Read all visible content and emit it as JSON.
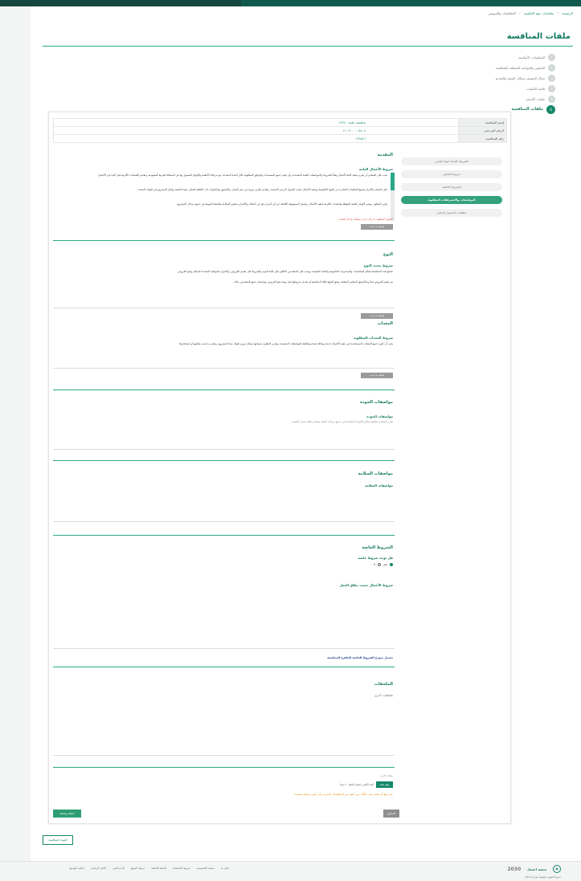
{
  "breadcrumb": [
    "الرئيسية",
    "منافسات جهة الحكومة",
    "المنافسات والعروض"
  ],
  "page_title": "ملفات المنافسة",
  "steps": [
    {
      "num": "1",
      "label": "المعلومات الأساسية"
    },
    {
      "num": "2",
      "label": "العناوين والمواعيد المتعلقة بالمنافسة"
    },
    {
      "num": "3",
      "label": "مجال التصنيف ومكان التنفيذ والتقديم"
    },
    {
      "num": "4",
      "label": "قائمة الكميات"
    },
    {
      "num": "5",
      "label": "ملفات الأسعار"
    },
    {
      "num": "6",
      "label": "ملفات المنافسة"
    }
  ],
  "summary": [
    {
      "label": "إسم المنافسة",
      "value": "منافسة عامة - ١٢٣٤"
    },
    {
      "label": "الرقم المرجعي",
      "value": "٢١٠٣٠٠٠٠٠٥٤٠٨"
    },
    {
      "label": "رقم المنافسة",
      "value": "١٢٣٥٤٦"
    }
  ],
  "tabs": [
    {
      "label": "الشروط العامة/ أنواع التقارير"
    },
    {
      "label": "شروط الفحص"
    },
    {
      "label": "الشروط الخاصة"
    },
    {
      "label": "المواصفات والاشتراطات المطلوبة"
    },
    {
      "label": "متطلبات المحتوى المحلي"
    }
  ],
  "sections": {
    "scope": {
      "title": "المقدمة",
      "sub": "شروط الأعمال العامة",
      "para1": "يجب على المتقدم أن يلتزم بتنفيذ كافة الأعمال وفقاً للشروط والمواصفات الفنية المعتمدة، وأن يقدم جميع المستندات والوثائق المطلوبة خلال المدة المحددة، مع مراعاة الأنظمة واللوائح المعمول بها في المملكة العربية السعودية، وتقديم الضمانات اللازمة قبل البدء في الأعمال.",
      "para2": "على المتقدم الالتزام بجميع التعليمات الصادرة من الجهة الحكومية وتنفيذ الأعمال حسب الجدول الزمني المعتمد، وتقديم تقارير دورية عن سير العمل، والتنسيق مع الجهات ذات العلاقة لضمان جودة التنفيذ وإنجاز المشروع في الوقت المحدد.",
      "para3": "يلتزم المقاول بتوفير الكوادر الفنية المؤهلة والمعدات اللازمة لتنفيذ الأعمال، وتحمل المسؤولية الكاملة عن أي أضرار تنتج عن أعماله، والالتزام بمعايير السلامة والصحة المهنية في جميع مراحل المشروع.",
      "note": "الحقول المطلوبة ما زالت فارغة وتتطلب إدخال البيانات",
      "btn": "إضافة بند جديد"
    },
    "subject": {
      "title": "النوع",
      "sub": "شروط تحديد النوع",
      "para1": "تخضع هذه المنافسة لنظام المنافسات والمشتريات الحكومية ولائحته التنفيذية، ويجب على المتقدمين الاطلاع على كافة البنود والشروط قبل تقديم العروض، والالتزام بالمواعيد المحددة لاستلام وفتح العروض.",
      "para2": "يتم تقييم العروض فنياً ومالياً وفق المعايير المعلنة، ويحق للجهة إلغاء المنافسة أو تعديل شروطها قبل موعد فتح العروض مع إشعار جميع المتقدمين بذلك.",
      "btn": "إضافة بند جديد"
    },
    "works": {
      "title": "المعدات",
      "sub": "شروط المعدات المطلوبة",
      "para1": "يجب أن تكون جميع المعدات المستخدمة في تنفيذ الأعمال حديثة وبحالة جيدة ومطابقة للمواصفات المعتمدة، ويلتزم المقاول بصيانتها بشكل دوري طوال مدة المشروع، وتقديم ما يثبت ملكيتها أو استئجارها.",
      "btn": "إضافة بند جديد"
    },
    "quality": {
      "title": "مواصفات الجودة",
      "sub": "مواصفات الجودة",
      "para1": "يلتزم المتقدم بتطبيق معايير الجودة المعتمدة في جميع مراحل التنفيذ وتقديم خطة ضمان الجودة."
    },
    "safety": {
      "title": "مواصفات السلامة",
      "sub": "مواصفات السلامة"
    },
    "special": {
      "title": "الشروط الخاصة",
      "question": "هل توجد شروط خاصة",
      "yes": "نعم",
      "no": "لا",
      "sub": "شروط الأعمال حسب نطاق العمل",
      "link": "تحميل نموذج الشروط الخاصة الجاهزة للمنافسة"
    },
    "attachments": {
      "title": "الملحقات",
      "sub": "ملحقات أخرى"
    },
    "upload": {
      "label": "ملفات أخرى",
      "button": "رفع ملف",
      "hint": "الحد الأقصى لحجم الملف ٢٠ ميجا",
      "warning": "عند رفع أي ملف يجب التأكد من خلوه من المعلومات السرية وأن يكون بصيغة معتمدة"
    }
  },
  "buttons": {
    "save": "حفظ ومتابعة",
    "prev": "السابق",
    "back": "العودة للمنافسة"
  },
  "footer": {
    "links": [
      "اتصل بنا",
      "سياسة الخصوصية",
      "شروط الاستخدام",
      "الأسئلة الشائعة",
      "خريطة الموقع",
      "الدعم الفني",
      "الدليل الإرشادي",
      "إمكانية الوصول"
    ],
    "logo": "منصة اعتماد",
    "vision": "2030",
    "copyright": "جميع الحقوق محفوظة لوزارة المالية"
  },
  "colors": {
    "primary": "#14876a",
    "accent": "#2aa889",
    "warning": "#e19b1f",
    "error": "#d9534f"
  }
}
